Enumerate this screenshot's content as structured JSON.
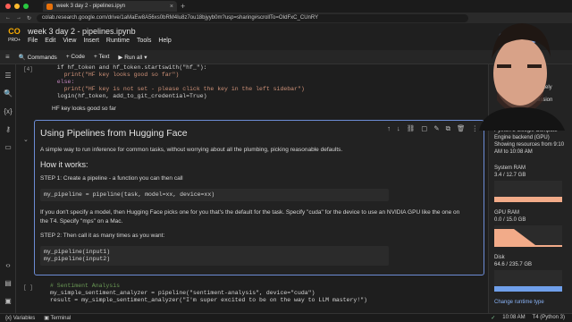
{
  "browser": {
    "tab_title": "week 3 day 2 - pipelines.ipyn",
    "url": "colab.research.google.com/drive/1aMaEw8A56xs0bRM4Iu8z7ou18bjyyb0m?usp=sharing#scrollTo=OIdFxC_CUnRY"
  },
  "colab": {
    "logo_text": "CO",
    "logo_sub": "PRO+",
    "notebook_title": "week 3 day 2 - pipelines.ipynb",
    "menu": [
      "File",
      "Edit",
      "View",
      "Insert",
      "Runtime",
      "Tools",
      "Help"
    ],
    "share_label": "re"
  },
  "toolbar": {
    "commands": "Commands",
    "code": "+ Code",
    "text": "+ Text",
    "run_all": "Run all"
  },
  "cells": {
    "prev_num": "[4]",
    "prev_lines": [
      "  if hf_token and hf_token.startswith(\"hf_\"):",
      "    print(\"HF key looks good so far\")",
      "  else:",
      "    print(\"HF key is not set - please click the key in the left sidebar\")",
      "  login(hf_token, add_to_git_credential=True)"
    ],
    "output": "HF key looks good so far",
    "md_title": "Using Pipelines from Hugging Face",
    "md_intro": "A simple way to run inference for common tasks, without worrying about all the plumbing, picking reasonable defaults.",
    "md_how": "How it works:",
    "md_step1": "STEP 1: Create a pipeline - a function you can then call",
    "md_code1": "my_pipeline = pipeline(task, model=xx, device=xx)",
    "md_note": "If you don't specify a model, then Hugging Face picks one for you that's the default for the task. Specify \"cuda\" for the device to use an NVIDIA GPU like the one on the T4. Specify \"mps\" on a Mac.",
    "md_step2": "STEP 2: Then call it as many times as you want:",
    "md_code2": [
      "my_pipeline(input1)",
      "my_pipeline(input2)"
    ],
    "next_num": "[ ]",
    "next_lines": [
      "# Sentiment Analysis",
      "",
      "my_simple_sentiment_analyzer = pipeline(\"sentiment-analysis\", device=\"cuda\")",
      "result = my_simple_sentiment_analyzer(\"I'm super excited to be on the way to LLM mastery!\")"
    ]
  },
  "right_panel": {
    "partial1": "proximately",
    "partial2": "e session",
    "runtime_desc": "Python 3 Google Compute Engine backend (GPU)",
    "resources_since": "Showing resources from 9:10 AM to 10:08 AM",
    "sys_ram_label": "System RAM",
    "sys_ram_value": "3.4 / 12.7 GB",
    "gpu_ram_label": "GPU RAM",
    "gpu_ram_value": "0.0 / 15.0 GB",
    "disk_label": "Disk",
    "disk_value": "64.6 / 235.7 GB",
    "change_runtime": "Change runtime type",
    "sys_ram_fraction": 0.27,
    "gpu_ram_fraction": 0.0,
    "disk_fraction": 0.27
  },
  "statusbar": {
    "variables": "Variables",
    "terminal": "Terminal",
    "time": "10:08 AM",
    "runtime": "T4 (Python 3)"
  }
}
